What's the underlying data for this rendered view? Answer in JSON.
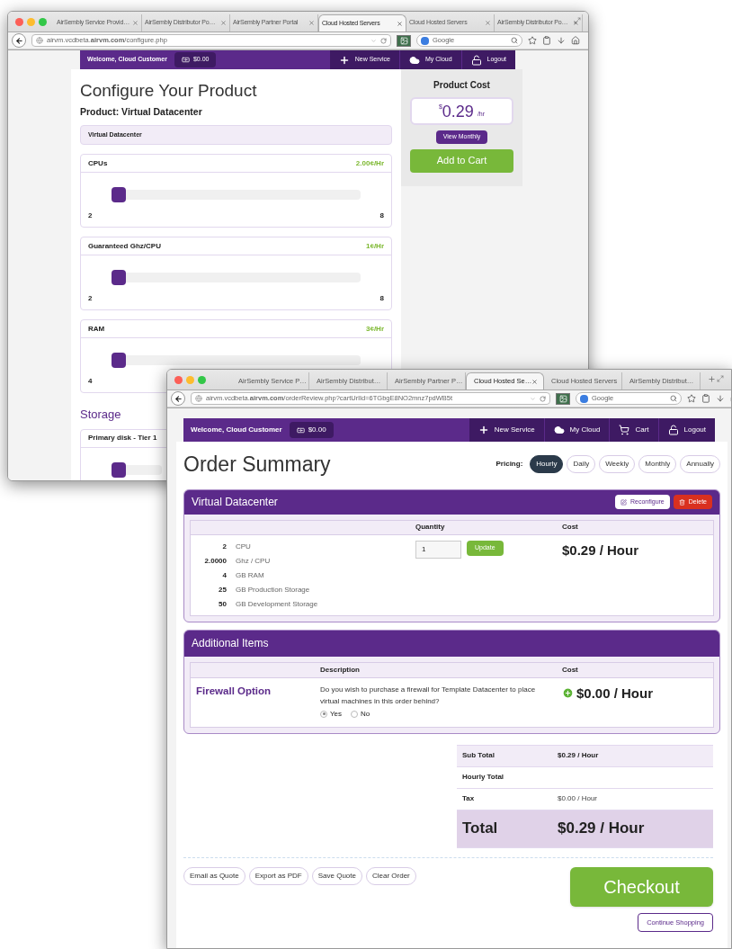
{
  "back_window": {
    "tabs": [
      {
        "label": "AirSembly Service Provid…",
        "selected": false
      },
      {
        "label": "AirSembly Distributor Po…",
        "selected": false
      },
      {
        "label": "AirSembly Partner Portal",
        "selected": false
      },
      {
        "label": "Cloud Hosted Servers",
        "selected": true
      },
      {
        "label": "Cloud Hosted Servers",
        "selected": false
      },
      {
        "label": "AirSembly Distributor Po…",
        "selected": false
      }
    ],
    "url": "airvm.vcdbeta.**airvm.com**/configure.php",
    "search_placeholder": "Google",
    "nav": {
      "welcome": "Welcome, Cloud Customer",
      "balance": "$0.00",
      "items": [
        {
          "kind": "new",
          "label": "New Service"
        },
        {
          "kind": "cloud",
          "label": "My Cloud"
        },
        {
          "kind": "logout",
          "label": "Logout"
        }
      ]
    },
    "title": "Configure Your Product",
    "product_label": "Product: Virtual Datacenter",
    "product_box": "Virtual Datacenter",
    "sliders": [
      {
        "name": "CPUs",
        "rate": "2.00¢/Hr",
        "level": 0,
        "min": "2",
        "max": "8"
      },
      {
        "name": "Guaranteed Ghz/CPU",
        "rate": "1¢/Hr",
        "level": 0,
        "min": "2",
        "max": "8"
      },
      {
        "name": "RAM",
        "rate": "3¢/Hr",
        "level": 0,
        "min": "4"
      }
    ],
    "storage_heading": "Storage",
    "storage_sliders": [
      {
        "name": "Primary disk - Tier 1",
        "level": 0
      }
    ],
    "cost": {
      "title": "Product Cost",
      "currency": "$",
      "amount": "0.29",
      "unit": "/hr",
      "view_monthly": "View Monthly",
      "add_to_cart": "Add to Cart"
    }
  },
  "front_window": {
    "tabs": [
      {
        "label": "AirSembly Service P…",
        "selected": false
      },
      {
        "label": "AirSembly Distribut…",
        "selected": false
      },
      {
        "label": "AirSembly Partner P…",
        "selected": false
      },
      {
        "label": "Cloud Hosted Se…",
        "selected": true
      },
      {
        "label": "Cloud Hosted Servers",
        "selected": false
      },
      {
        "label": "AirSembly Distribut…",
        "selected": false
      }
    ],
    "url": "airvm.vcdbeta.**airvm.com**/orderReview.php?cartUrlId=6TGbgE8NO2mnz7pdWB5t",
    "search_placeholder": "Google",
    "nav": {
      "welcome": "Welcome, Cloud Customer",
      "balance": "$0.00",
      "items": [
        {
          "kind": "new",
          "label": "New Service"
        },
        {
          "kind": "cloud",
          "label": "My Cloud"
        },
        {
          "kind": "cart",
          "label": "Cart"
        },
        {
          "kind": "logout",
          "label": "Logout"
        }
      ]
    },
    "title": "Order Summary",
    "pricing_label": "Pricing:",
    "pricing": [
      {
        "label": "Hourly",
        "selected": true
      },
      {
        "label": "Daily",
        "selected": false
      },
      {
        "label": "Weekly",
        "selected": false
      },
      {
        "label": "Monthly",
        "selected": false
      },
      {
        "label": "Annually",
        "selected": false
      }
    ],
    "product": {
      "name": "Virtual Datacenter",
      "reconfigure": "Reconfigure",
      "delete": "Delete",
      "columns": [
        "Quantity",
        "Cost"
      ],
      "specs": [
        {
          "value": "2",
          "label": "CPU"
        },
        {
          "value": "2.0000",
          "label": "Ghz / CPU"
        },
        {
          "value": "4",
          "label": "GB RAM"
        },
        {
          "value": "25",
          "label": "GB Production Storage"
        },
        {
          "value": "50",
          "label": "GB Development Storage"
        }
      ],
      "quantity": "1",
      "update": "Update",
      "cost": "$0.29 / Hour"
    },
    "additional": {
      "title": "Additional Items",
      "columns": [
        "Description",
        "Cost"
      ],
      "items": [
        {
          "name": "Firewall Option",
          "description": "Do you wish to purchase a firewall for Template Datacenter to place virtual machines in this order behind?",
          "options": [
            {
              "label": "Yes",
              "selected": true
            },
            {
              "label": "No",
              "selected": false
            }
          ],
          "cost": "$0.00 / Hour"
        }
      ]
    },
    "totals": [
      {
        "kind": "subtotal",
        "label": "Sub Total",
        "value": "$0.29 / Hour"
      },
      {
        "kind": "heading",
        "label": "Hourly Total"
      },
      {
        "kind": "tax",
        "label": "Tax",
        "value": "$0.00 / Hour"
      },
      {
        "kind": "total",
        "label": "Total",
        "value": "$0.29 / Hour"
      }
    ],
    "actions": [
      "Email as Quote",
      "Export as PDF",
      "Save Quote",
      "Clear Order"
    ],
    "checkout": "Checkout",
    "continue": "Continue Shopping"
  }
}
